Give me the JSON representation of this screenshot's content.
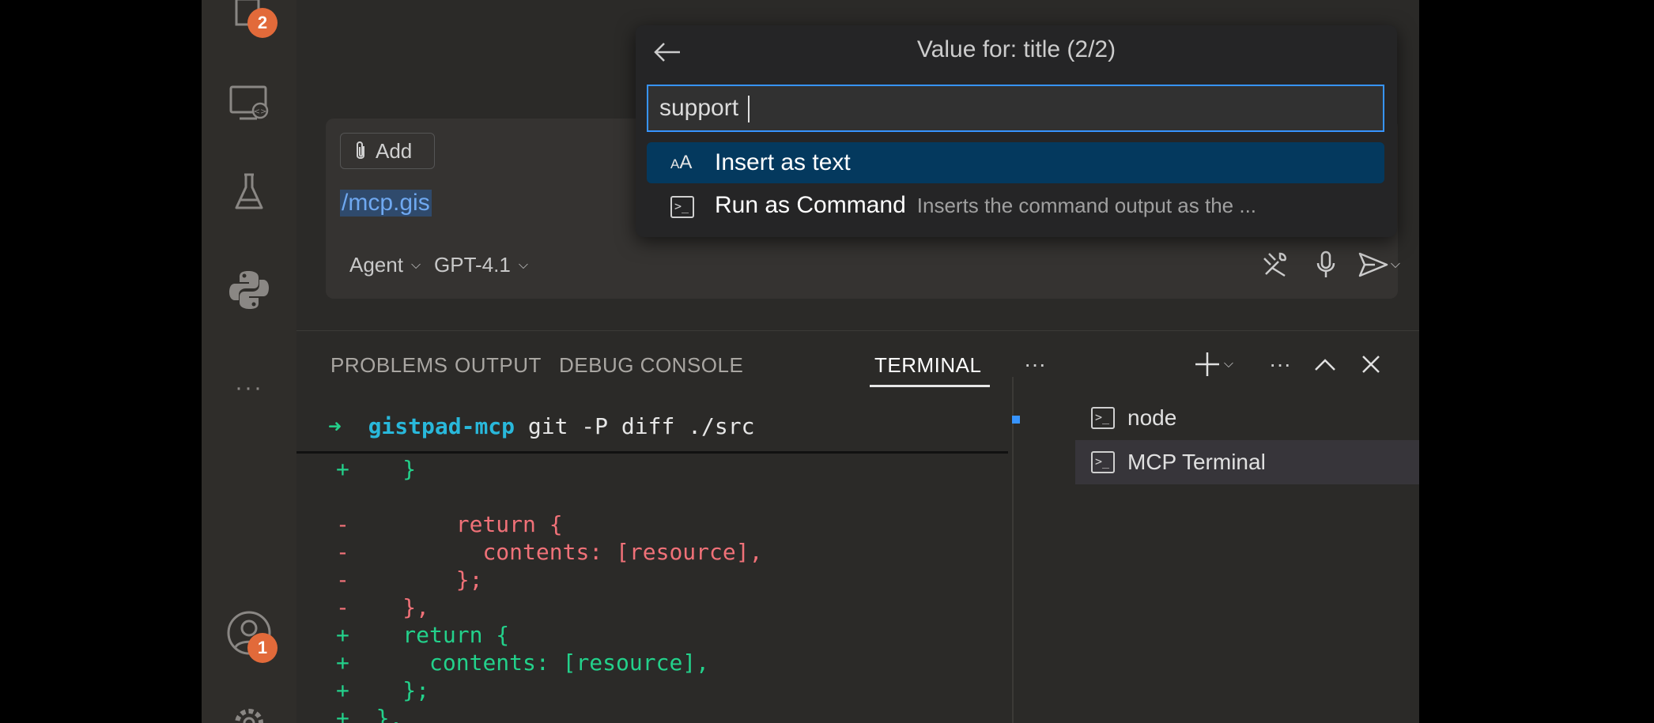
{
  "activity_bar": {
    "explorer_badge": "2",
    "account_badge": "1",
    "more": "···"
  },
  "chat": {
    "add_context_label": "Add",
    "input_text": "/mcp.gis",
    "mode_select": "Agent",
    "model_select": "GPT-4.1"
  },
  "quick_pick": {
    "title": "Value for: title (2/2)",
    "input_value": "support ",
    "items": [
      {
        "icon_text": "AA",
        "label": "Insert as text",
        "description": ""
      },
      {
        "icon_text": ">_",
        "label": "Run as Command",
        "description": "Inserts the command output as the ..."
      }
    ]
  },
  "panel": {
    "tabs": [
      "PROBLEMS",
      "OUTPUT",
      "DEBUG CONSOLE",
      "TERMINAL"
    ],
    "active_tab": "TERMINAL",
    "overflow": "···",
    "more_actions": "···"
  },
  "terminal": {
    "prompt_arrow": "➜",
    "prompt_dir": "gistpad-mcp",
    "prompt_cmd": "git -P diff ./src",
    "lines": [
      {
        "sign": "+",
        "code": "  }"
      },
      {
        "sign": "",
        "code": ""
      },
      {
        "sign": "-",
        "code": "      return {"
      },
      {
        "sign": "-",
        "code": "        contents: [resource],"
      },
      {
        "sign": "-",
        "code": "      };"
      },
      {
        "sign": "-",
        "code": "  },"
      },
      {
        "sign": "+",
        "code": "  return {"
      },
      {
        "sign": "+",
        "code": "    contents: [resource],"
      },
      {
        "sign": "+",
        "code": "  };"
      },
      {
        "sign": "+",
        "code": "},"
      }
    ]
  },
  "terminal_list": [
    {
      "name": "node"
    },
    {
      "name": "MCP Terminal"
    }
  ],
  "colors": {
    "accent": "#3794ff",
    "selection": "#04395e",
    "badge": "#e26a3a",
    "diff_add": "#23d18b",
    "diff_remove": "#f07178"
  }
}
